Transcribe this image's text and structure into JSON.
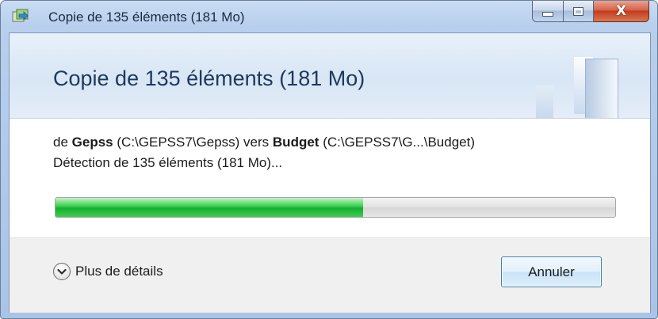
{
  "window": {
    "title": "Copie de 135 éléments (181 Mo)",
    "controls": {
      "minimize_icon": "minimize-icon",
      "maximize_icon": "maximize-icon",
      "close_label": "X"
    }
  },
  "header": {
    "title": "Copie de 135 éléments (181 Mo)"
  },
  "transfer": {
    "from_prefix": "de",
    "source_name": "Gepss",
    "source_path": "(C:\\GEPSS7\\Gepss)",
    "to_word": "vers",
    "dest_name": "Budget",
    "dest_path": "(C:\\GEPSS7\\G...\\Budget)",
    "status": "Détection de 135 éléments (181 Mo)...",
    "progress_percent": 55
  },
  "footer": {
    "details_label": "Plus de détails",
    "cancel_label": "Annuler"
  },
  "colors": {
    "progress_green": "#13b12e",
    "close_red": "#c23b1e",
    "header_title": "#1e395b"
  }
}
